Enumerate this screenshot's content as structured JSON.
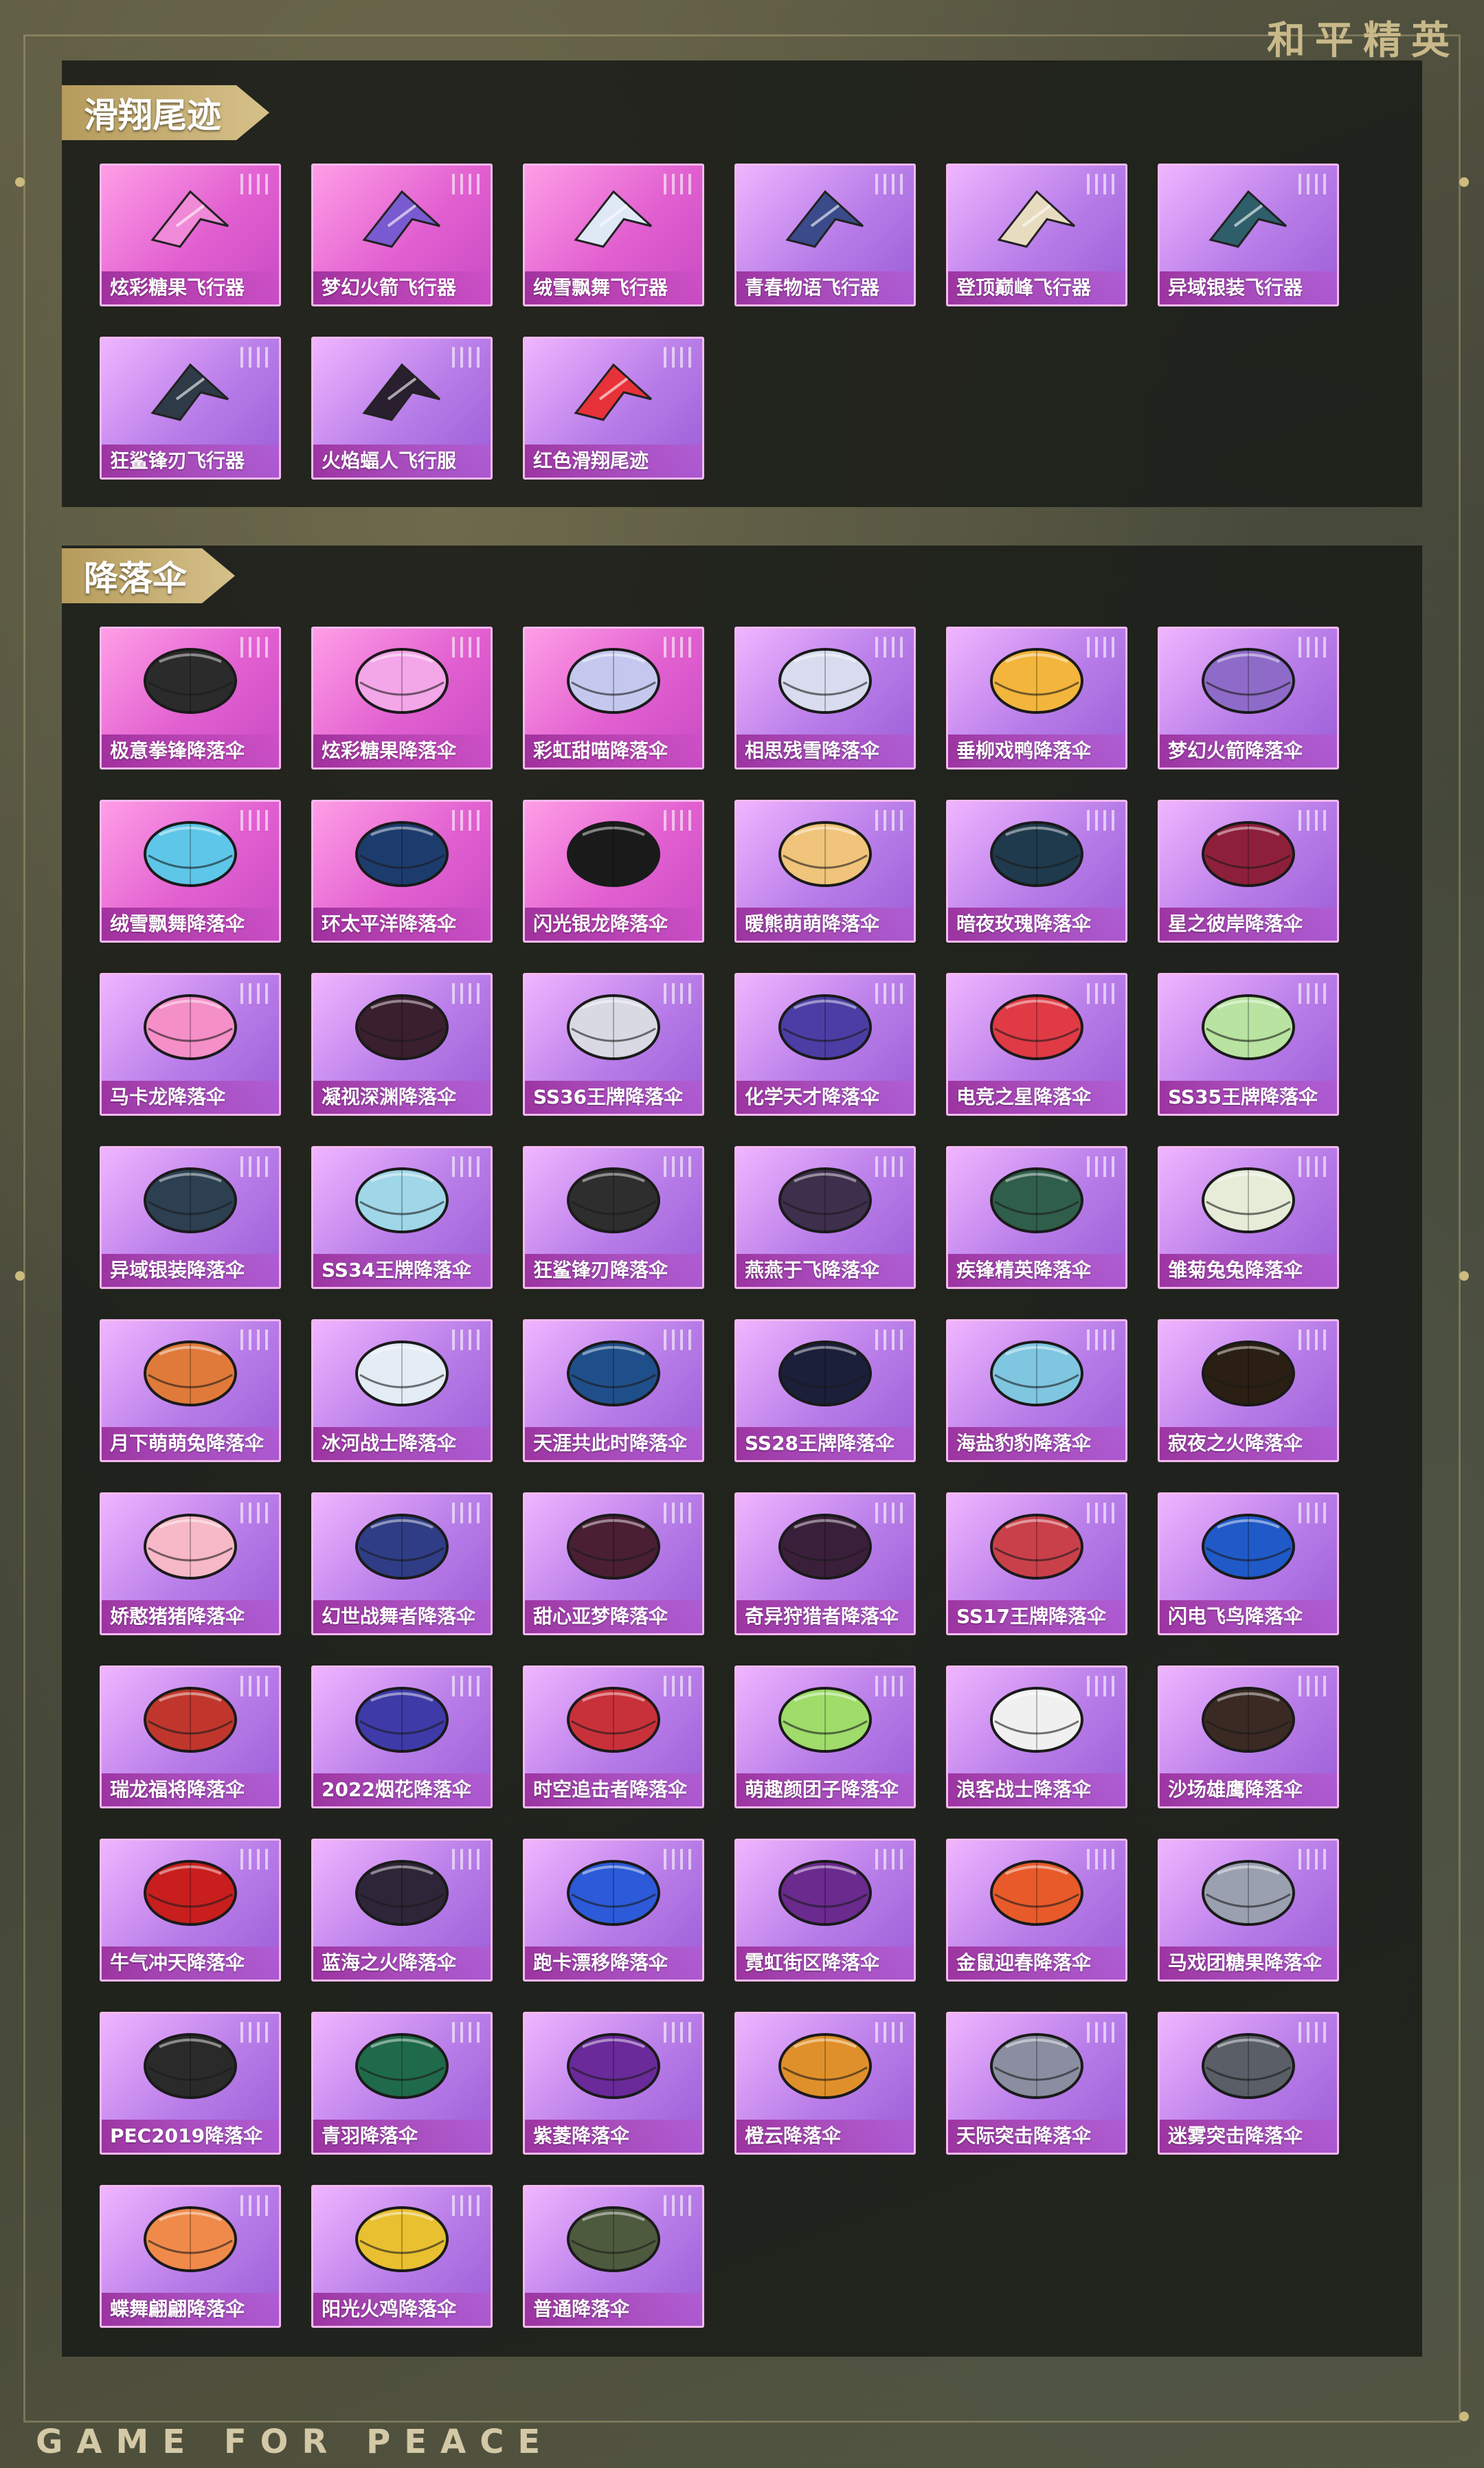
{
  "brand": {
    "top": "和平精英",
    "bottom": "GAME FOR PEACE"
  },
  "trails": {
    "title": "滑翔尾迹",
    "items": [
      {
        "label": "炫彩糖果飞行器",
        "icon": "candy-glider-icon"
      },
      {
        "label": "梦幻火箭飞行器",
        "icon": "rocket-glider-icon"
      },
      {
        "label": "绒雪飘舞飞行器",
        "icon": "snow-glider-icon"
      },
      {
        "label": "青春物语飞行器",
        "icon": "wing-glider-icon"
      },
      {
        "label": "登顶巅峰飞行器",
        "icon": "peak-glider-icon"
      },
      {
        "label": "异域银装飞行器",
        "icon": "silver-glider-icon"
      },
      {
        "label": "狂鲨锋刃飞行器",
        "icon": "shark-glider-icon"
      },
      {
        "label": "火焰蝠人飞行服",
        "icon": "wingsuit-icon"
      },
      {
        "label": "红色滑翔尾迹",
        "icon": "red-trail-icon"
      }
    ]
  },
  "parachutes": {
    "title": "降落伞",
    "items": [
      {
        "label": "极意拳锋降落伞",
        "color": "#2b2b2b"
      },
      {
        "label": "炫彩糖果降落伞",
        "color": "#f3a6e8"
      },
      {
        "label": "彩虹甜喵降落伞",
        "color": "#c5c8ee"
      },
      {
        "label": "相思残雪降落伞",
        "color": "#d8dcee"
      },
      {
        "label": "垂柳戏鸭降落伞",
        "color": "#f3b53c"
      },
      {
        "label": "梦幻火箭降落伞",
        "color": "#8e6bc9"
      },
      {
        "label": "绒雪飘舞降落伞",
        "color": "#5ec6e8"
      },
      {
        "label": "环太平洋降落伞",
        "color": "#1d3c6e"
      },
      {
        "label": "闪光银龙降落伞",
        "color": "#1a1a1a"
      },
      {
        "label": "暖熊萌萌降落伞",
        "color": "#f0c47a"
      },
      {
        "label": "暗夜玫瑰降落伞",
        "color": "#1f3a4d"
      },
      {
        "label": "星之彼岸降落伞",
        "color": "#8e1f3b"
      },
      {
        "label": "马卡龙降落伞",
        "color": "#f58fc8"
      },
      {
        "label": "凝视深渊降落伞",
        "color": "#3a1f2e"
      },
      {
        "label": "SS36王牌降落伞",
        "color": "#d9d9e4"
      },
      {
        "label": "化学天才降落伞",
        "color": "#4a3ea5"
      },
      {
        "label": "电竞之星降落伞",
        "color": "#e03a45"
      },
      {
        "label": "SS35王牌降落伞",
        "color": "#b8e3a0"
      },
      {
        "label": "异域银装降落伞",
        "color": "#2c4052"
      },
      {
        "label": "SS34王牌降落伞",
        "color": "#9fd6e8"
      },
      {
        "label": "狂鲨锋刃降落伞",
        "color": "#2e2e2e"
      },
      {
        "label": "燕燕于飞降落伞",
        "color": "#3e2f4d"
      },
      {
        "label": "疾锋精英降落伞",
        "color": "#2f5e4a"
      },
      {
        "label": "雏菊兔兔降落伞",
        "color": "#e6ecd8"
      },
      {
        "label": "月下萌萌兔降落伞",
        "color": "#e07a3a"
      },
      {
        "label": "冰河战士降落伞",
        "color": "#e4ecf5"
      },
      {
        "label": "天涯共此时降落伞",
        "color": "#1f4f8a"
      },
      {
        "label": "SS28王牌降落伞",
        "color": "#1b1f3a"
      },
      {
        "label": "海盐豹豹降落伞",
        "color": "#7fc6e0"
      },
      {
        "label": "寂夜之火降落伞",
        "color": "#2a1f12"
      },
      {
        "label": "娇憨猪猪降落伞",
        "color": "#f7b8c8"
      },
      {
        "label": "幻世战舞者降落伞",
        "color": "#2f3d86"
      },
      {
        "label": "甜心亚梦降落伞",
        "color": "#4a1f33"
      },
      {
        "label": "奇异狩猎者降落伞",
        "color": "#3a1f3a"
      },
      {
        "label": "SS17王牌降落伞",
        "color": "#c9404a"
      },
      {
        "label": "闪电飞鸟降落伞",
        "color": "#1f5ac8"
      },
      {
        "label": "瑞龙福将降落伞",
        "color": "#c0362c"
      },
      {
        "label": "2022烟花降落伞",
        "color": "#3e3aa8"
      },
      {
        "label": "时空追击者降落伞",
        "color": "#c8313a"
      },
      {
        "label": "萌趣颜团子降落伞",
        "color": "#9fdc6a"
      },
      {
        "label": "浪客战士降落伞",
        "color": "#f0f0f0"
      },
      {
        "label": "沙场雄鹰降落伞",
        "color": "#3b2a24"
      },
      {
        "label": "牛气冲天降落伞",
        "color": "#c81e1e"
      },
      {
        "label": "蓝海之火降落伞",
        "color": "#2f2538"
      },
      {
        "label": "跑卡漂移降落伞",
        "color": "#2c5ad8"
      },
      {
        "label": "霓虹街区降落伞",
        "color": "#6a2a8e"
      },
      {
        "label": "金鼠迎春降落伞",
        "color": "#e85a2a"
      },
      {
        "label": "马戏团糖果降落伞",
        "color": "#9aa0b0"
      },
      {
        "label": "PEC2019降落伞",
        "color": "#2a2a2a"
      },
      {
        "label": "青羽降落伞",
        "color": "#1f6a4a"
      },
      {
        "label": "紫菱降落伞",
        "color": "#6a2a9a"
      },
      {
        "label": "橙云降落伞",
        "color": "#e0902a"
      },
      {
        "label": "天际突击降落伞",
        "color": "#8a8ea0"
      },
      {
        "label": "迷雾突击降落伞",
        "color": "#5a5e66"
      },
      {
        "label": "蝶舞翩翩降落伞",
        "color": "#f08a4a"
      },
      {
        "label": "阳光火鸡降落伞",
        "color": "#e8c030"
      },
      {
        "label": "普通降落伞",
        "color": "#4e5a3e"
      }
    ]
  }
}
